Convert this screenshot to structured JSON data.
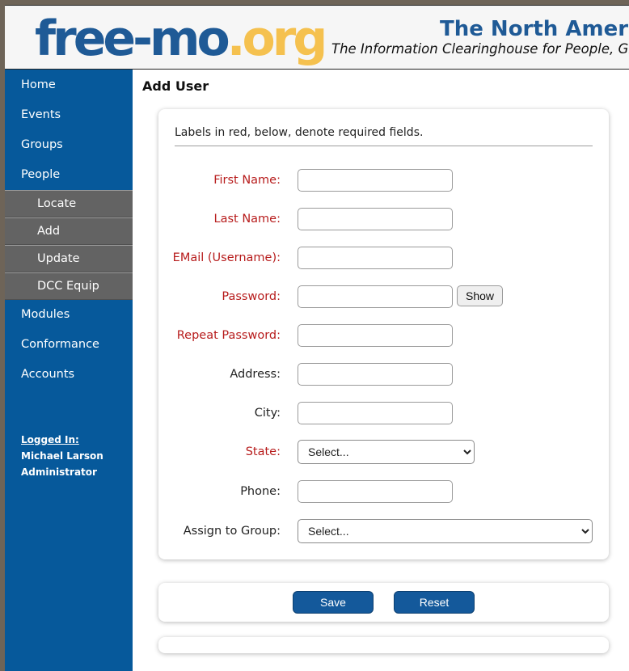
{
  "header": {
    "logo_part1": "free-mo",
    "logo_part2": ".org",
    "site_title": "The North Americ",
    "tagline": "The Information Clearinghouse for People, Gr"
  },
  "sidebar": {
    "items": [
      {
        "label": "Home"
      },
      {
        "label": "Events"
      },
      {
        "label": "Groups"
      },
      {
        "label": "People"
      }
    ],
    "sub_items": [
      {
        "label": "Locate"
      },
      {
        "label": "Add"
      },
      {
        "label": "Update"
      },
      {
        "label": "DCC Equip"
      }
    ],
    "items_after": [
      {
        "label": "Modules"
      },
      {
        "label": "Conformance"
      },
      {
        "label": "Accounts"
      }
    ],
    "logged_in_label": "Logged In:",
    "user_name": "Michael Larson",
    "user_role": "Administrator"
  },
  "main": {
    "title": "Add User",
    "note": "Labels in red, below, denote required fields.",
    "fields": {
      "first_name": {
        "label": "First Name:",
        "value": "",
        "required": true
      },
      "last_name": {
        "label": "Last Name:",
        "value": "",
        "required": true
      },
      "email": {
        "label": "EMail (Username):",
        "value": "",
        "required": true
      },
      "password": {
        "label": "Password:",
        "value": "",
        "required": true,
        "show_label": "Show"
      },
      "repeat_password": {
        "label": "Repeat Password:",
        "value": "",
        "required": true
      },
      "address": {
        "label": "Address:",
        "value": "",
        "required": false
      },
      "city": {
        "label": "City:",
        "value": "",
        "required": false
      },
      "state": {
        "label": "State:",
        "selected": "Select...",
        "required": true
      },
      "phone": {
        "label": "Phone:",
        "value": "",
        "required": false
      },
      "group": {
        "label": "Assign to Group:",
        "selected": "Select...",
        "required": false
      }
    },
    "buttons": {
      "save": "Save",
      "reset": "Reset"
    }
  },
  "colors": {
    "sidebar_bg": "#06599b",
    "submenu_bg": "#636363",
    "required_label": "#b71c1c",
    "logo_blue": "#1f5a96",
    "logo_yellow": "#f5c14f",
    "button_bg": "#14599b"
  }
}
